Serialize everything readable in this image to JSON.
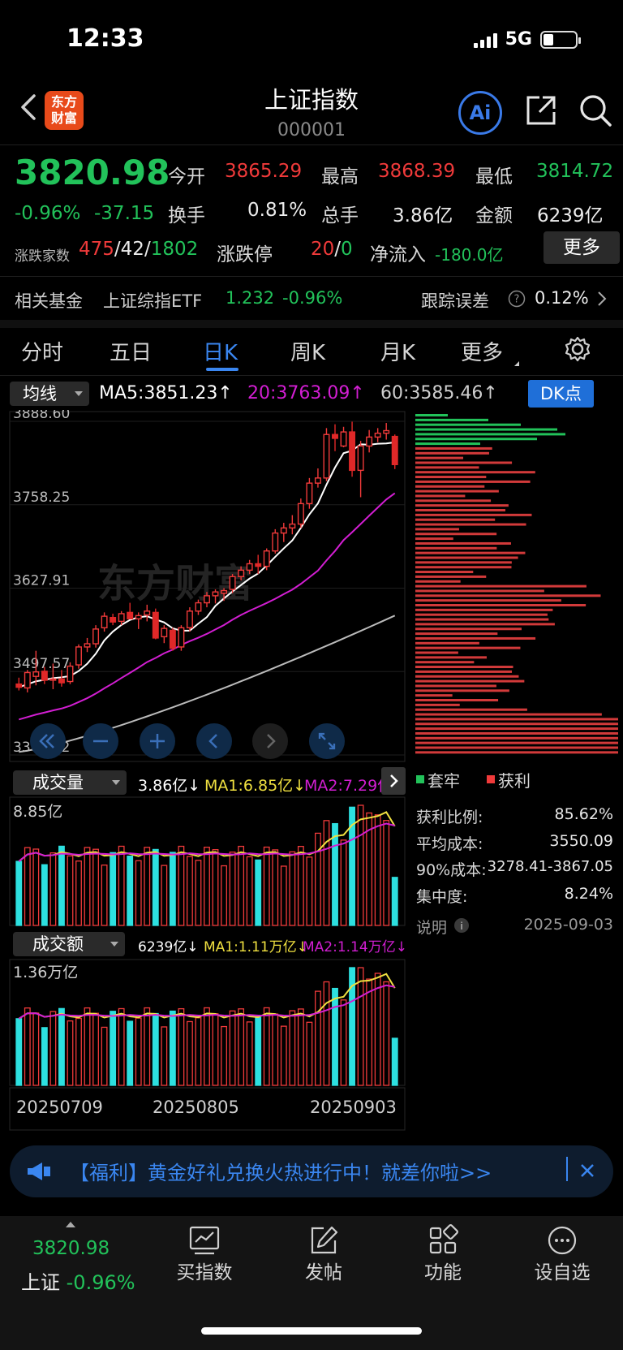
{
  "status_bar": {
    "time": "12:33",
    "network": "5G"
  },
  "header": {
    "logo_text": "东方\n财富",
    "title": "上证指数",
    "code": "000001",
    "ai_label": "Ai"
  },
  "quote": {
    "price": "3820.98",
    "change_pct": "-0.96%",
    "change_val": "-37.15",
    "open_label": "今开",
    "open": "3865.29",
    "high_label": "最高",
    "high": "3868.39",
    "low_label": "最低",
    "low": "3814.72",
    "turnover_label": "换手",
    "turnover": "0.81%",
    "volume_label": "总手",
    "volume": "3.86亿",
    "amount_label": "金额",
    "amount": "6239亿",
    "breadth_label": "涨跌家数",
    "breadth_up": "475",
    "breadth_flat": "42",
    "breadth_down": "1802",
    "limit_label": "涨跌停",
    "limit_up": "20",
    "limit_down": "0",
    "netflow_label": "净流入",
    "netflow": "-180.0亿",
    "more_label": "更多"
  },
  "fund": {
    "label": "相关基金",
    "name": "上证综指ETF",
    "price": "1.232",
    "pct": "-0.96%",
    "track_label": "跟踪误差",
    "track_value": "0.12%"
  },
  "tabs": [
    "分时",
    "五日",
    "日K",
    "周K",
    "月K",
    "更多"
  ],
  "ma": {
    "select_label": "均线",
    "ma5": "MA5:3851.23",
    "ma20": "20:3763.09",
    "ma60": "60:3585.46",
    "arrow": "↑",
    "dk_label": "DK点"
  },
  "kline_axis": [
    "3888.60",
    "3758.25",
    "3627.91",
    "3497.57",
    "3367.22"
  ],
  "watermark": "东方财富",
  "volume_panel": {
    "select_label": "成交量",
    "value": "3.86亿↓",
    "ma1": "MA1:6.85亿↓",
    "ma2": "MA2:7.29亿↓",
    "max": "8.85亿"
  },
  "amount_panel": {
    "select_label": "成交额",
    "value": "6239亿↓",
    "ma1": "MA1:1.11万亿↓",
    "ma2": "MA2:1.14万亿↓",
    "max": "1.36万亿"
  },
  "dates": [
    "20250709",
    "20250805",
    "20250903"
  ],
  "chip": {
    "legend_trapped": "套牢",
    "legend_profit": "获利",
    "profit_ratio_label": "获利比例:",
    "profit_ratio": "85.62%",
    "avg_cost_label": "平均成本:",
    "avg_cost": "3550.09",
    "cost90_label": "90%成本:",
    "cost90": "3278.41-3867.05",
    "concentration_label": "集中度:",
    "concentration": "8.24%",
    "note_label": "说明",
    "date": "2025-09-03"
  },
  "banner": {
    "text": "【福利】黄金好礼兑换火热进行中！就差你啦>>"
  },
  "bottom_nav": {
    "index_price": "3820.98",
    "index_name": "上证",
    "index_pct": "-0.96%",
    "items": [
      "买指数",
      "发帖",
      "功能",
      "设自选"
    ]
  },
  "colors": {
    "up": "#f03a3a",
    "down": "#22c25a",
    "accent": "#3a86f0",
    "ma5": "#ffffff",
    "ma20": "#d21ed2",
    "ma60": "#bbbbbb",
    "vol_down": "#2de0e0"
  },
  "chart_data": {
    "type": "candlestick",
    "y_axis_ticks": [
      3888.6,
      3758.25,
      3627.91,
      3497.57,
      3367.22
    ],
    "ylim": [
      3367.22,
      3888.6
    ],
    "x_ticks": [
      "20250709",
      "20250805",
      "20250903"
    ],
    "ohlc": [
      [
        3478,
        3488,
        3468,
        3473
      ],
      [
        3472,
        3500,
        3465,
        3496
      ],
      [
        3490,
        3530,
        3476,
        3497
      ],
      [
        3498,
        3505,
        3478,
        3484
      ],
      [
        3484,
        3510,
        3470,
        3486
      ],
      [
        3486,
        3500,
        3474,
        3480
      ],
      [
        3482,
        3512,
        3478,
        3506
      ],
      [
        3508,
        3540,
        3502,
        3536
      ],
      [
        3536,
        3550,
        3528,
        3541
      ],
      [
        3541,
        3570,
        3535,
        3564
      ],
      [
        3566,
        3590,
        3560,
        3584
      ],
      [
        3582,
        3588,
        3570,
        3575
      ],
      [
        3576,
        3592,
        3570,
        3588
      ],
      [
        3590,
        3605,
        3580,
        3580
      ],
      [
        3580,
        3590,
        3564,
        3585
      ],
      [
        3586,
        3602,
        3576,
        3592
      ],
      [
        3590,
        3596,
        3548,
        3550
      ],
      [
        3552,
        3570,
        3542,
        3565
      ],
      [
        3562,
        3566,
        3530,
        3534
      ],
      [
        3536,
        3570,
        3530,
        3566
      ],
      [
        3566,
        3598,
        3560,
        3592
      ],
      [
        3592,
        3610,
        3586,
        3605
      ],
      [
        3605,
        3622,
        3598,
        3616
      ],
      [
        3616,
        3626,
        3604,
        3622
      ],
      [
        3620,
        3628,
        3608,
        3624
      ],
      [
        3626,
        3650,
        3620,
        3646
      ],
      [
        3646,
        3662,
        3640,
        3656
      ],
      [
        3656,
        3672,
        3650,
        3666
      ],
      [
        3666,
        3680,
        3650,
        3662
      ],
      [
        3662,
        3690,
        3656,
        3686
      ],
      [
        3686,
        3720,
        3682,
        3714
      ],
      [
        3714,
        3730,
        3700,
        3722
      ],
      [
        3722,
        3742,
        3712,
        3728
      ],
      [
        3728,
        3768,
        3722,
        3760
      ],
      [
        3760,
        3800,
        3752,
        3792
      ],
      [
        3792,
        3815,
        3785,
        3800
      ],
      [
        3800,
        3878,
        3795,
        3868
      ],
      [
        3868,
        3884,
        3842,
        3862
      ],
      [
        3850,
        3880,
        3848,
        3872
      ],
      [
        3872,
        3888,
        3802,
        3812
      ],
      [
        3812,
        3858,
        3770,
        3850
      ],
      [
        3850,
        3875,
        3840,
        3864
      ],
      [
        3864,
        3878,
        3856,
        3870
      ],
      [
        3870,
        3886,
        3860,
        3874
      ],
      [
        3865,
        3868,
        3814,
        3821
      ]
    ]
  }
}
